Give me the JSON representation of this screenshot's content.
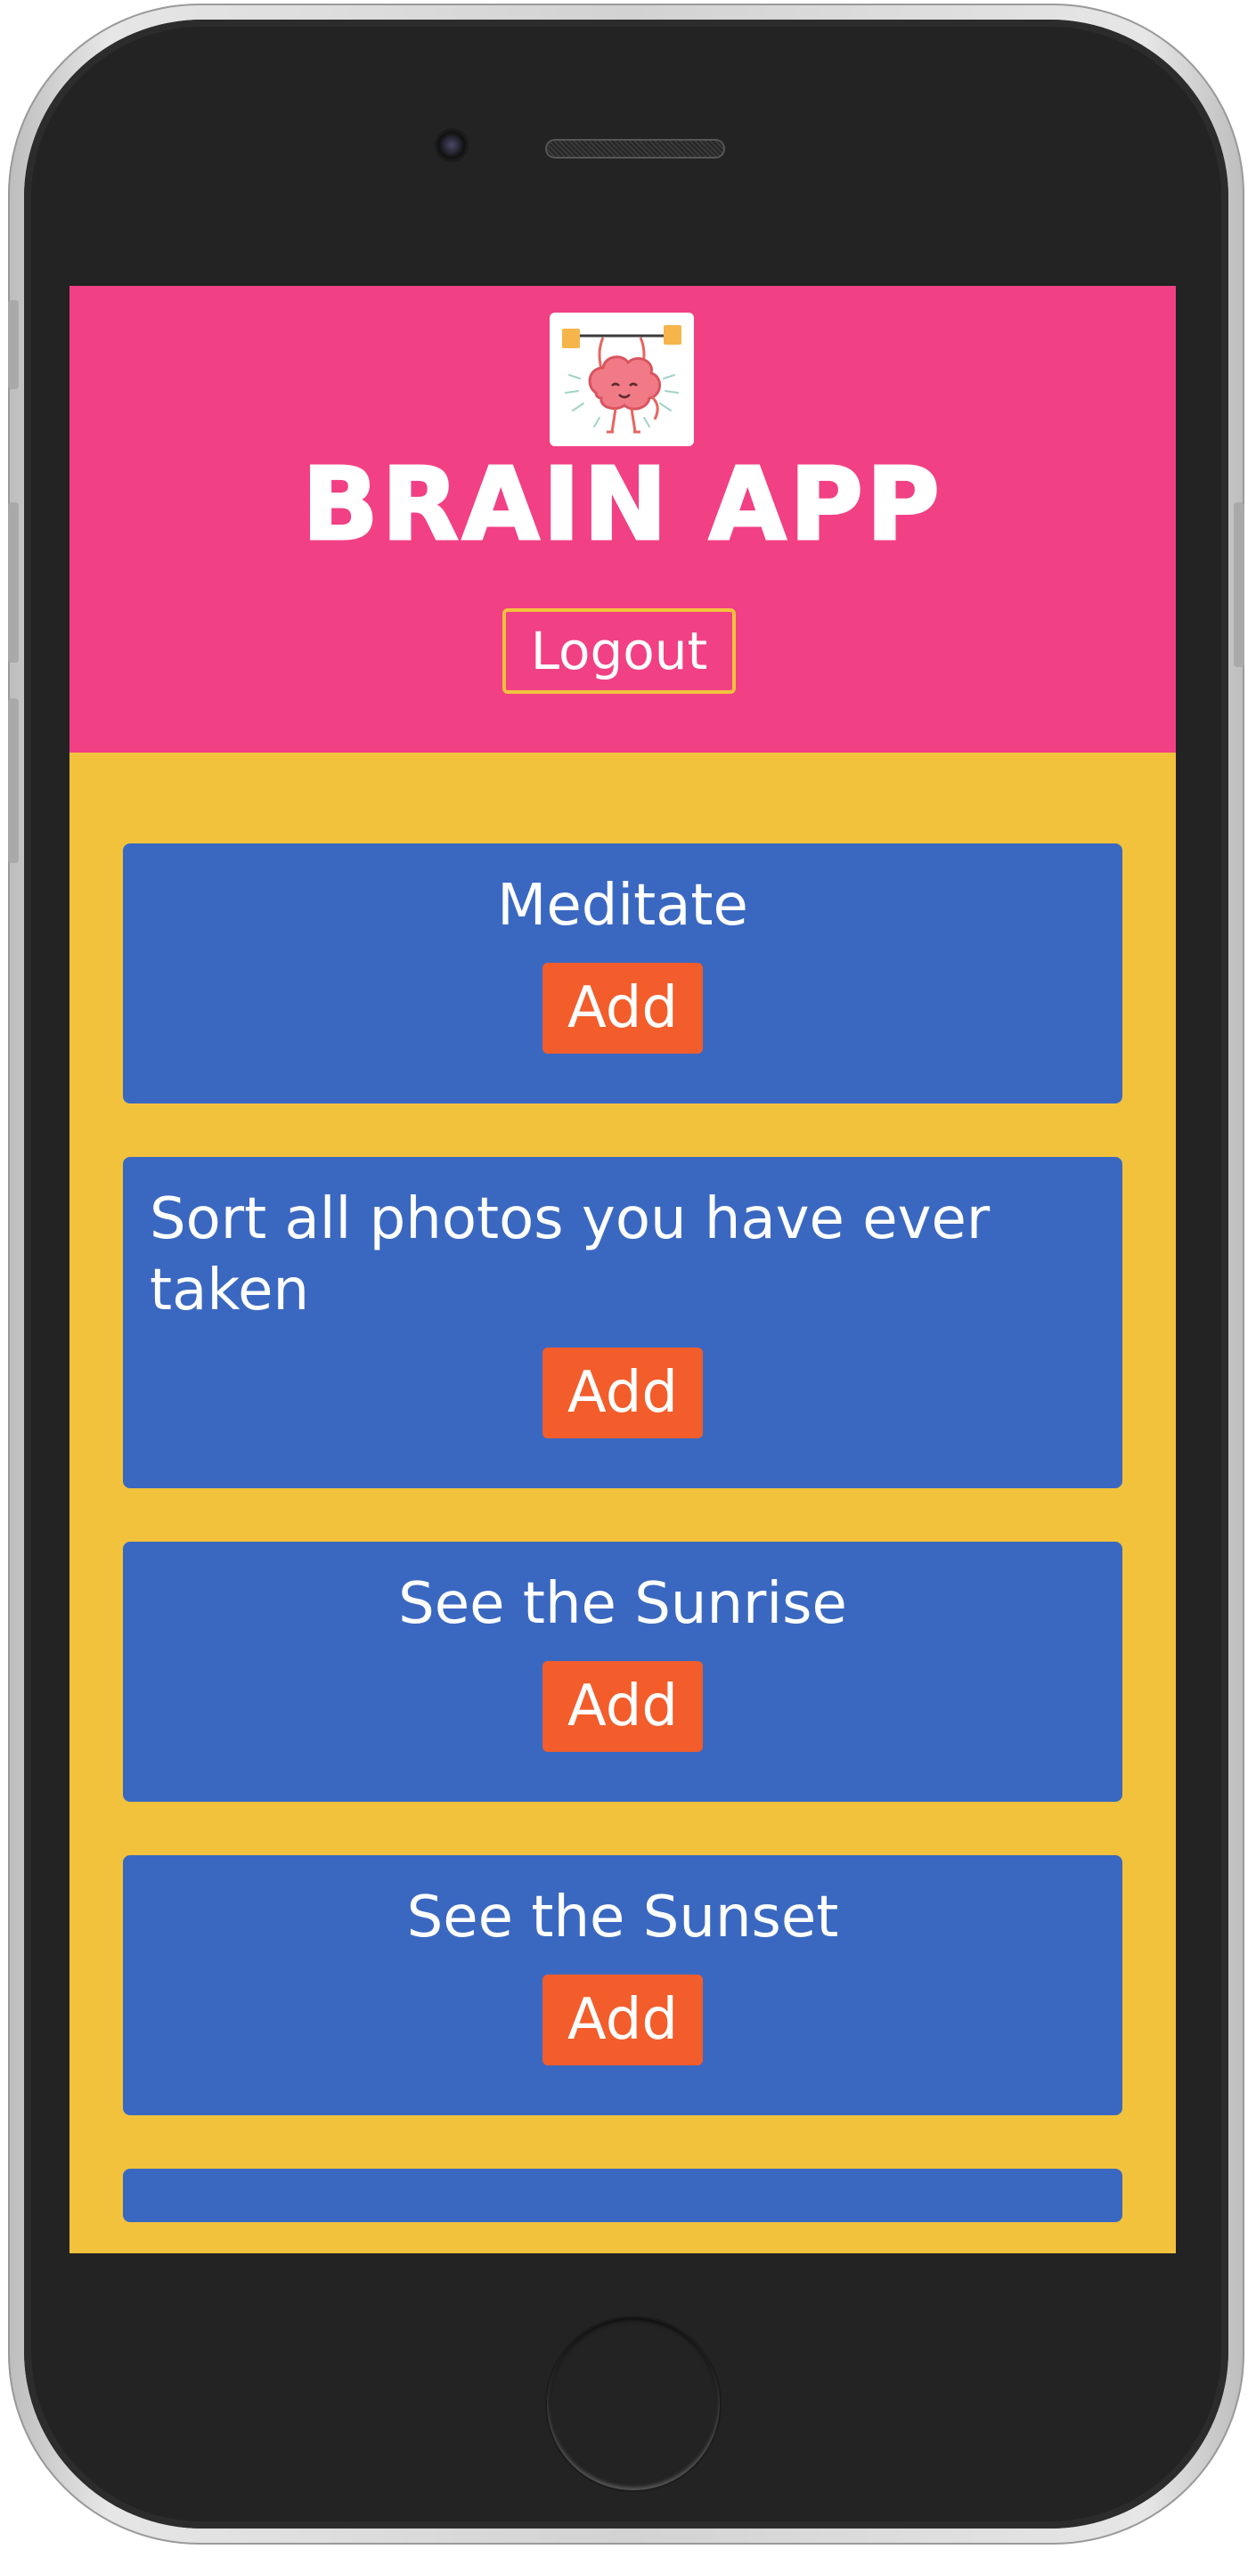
{
  "header": {
    "title": "BRAIN APP",
    "logout_label": "Logout"
  },
  "tasks": [
    {
      "title": "Meditate",
      "add_label": "Add"
    },
    {
      "title": "Sort all photos you have ever taken",
      "add_label": "Add"
    },
    {
      "title": "See the Sunrise",
      "add_label": "Add"
    },
    {
      "title": "See the Sunset",
      "add_label": "Add"
    }
  ],
  "colors": {
    "header_bg": "#f24084",
    "page_bg": "#f2c23d",
    "card_bg": "#3a68c1",
    "add_button_bg": "#f25d2b"
  },
  "icons": {
    "logo": "brain-lifting-weights-logo"
  }
}
